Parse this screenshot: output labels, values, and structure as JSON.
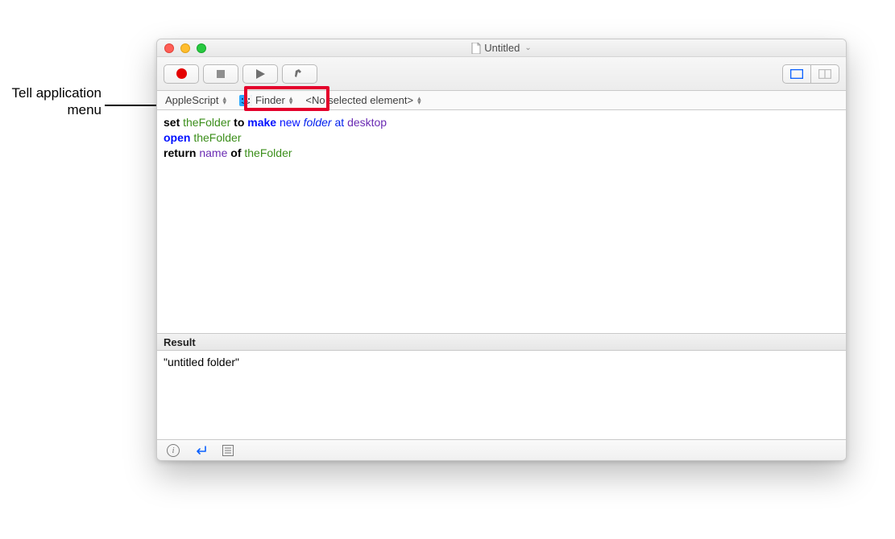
{
  "annotation": {
    "label": "Tell application menu"
  },
  "window": {
    "title": "Untitled"
  },
  "toolbar": {
    "record": "record-button",
    "stop": "stop-button",
    "run": "run-button",
    "compile": "compile-button",
    "view_mode_active": "left"
  },
  "navbar": {
    "language": "AppleScript",
    "app": "Finder",
    "element": "<No selected element>"
  },
  "script": {
    "line1": {
      "set": "set",
      "var": "theFolder",
      "to": "to",
      "make": "make",
      "new": "new",
      "folder": "folder",
      "at": "at",
      "desktop": "desktop"
    },
    "line2": {
      "open": "open",
      "var": "theFolder"
    },
    "line3": {
      "return": "return",
      "name": "name",
      "of": "of",
      "var": "theFolder"
    }
  },
  "result": {
    "header": "Result",
    "value": "\"untitled folder\""
  },
  "bottombar": {
    "info": "info-button",
    "replies": "return-log-button",
    "events": "event-log-button"
  }
}
